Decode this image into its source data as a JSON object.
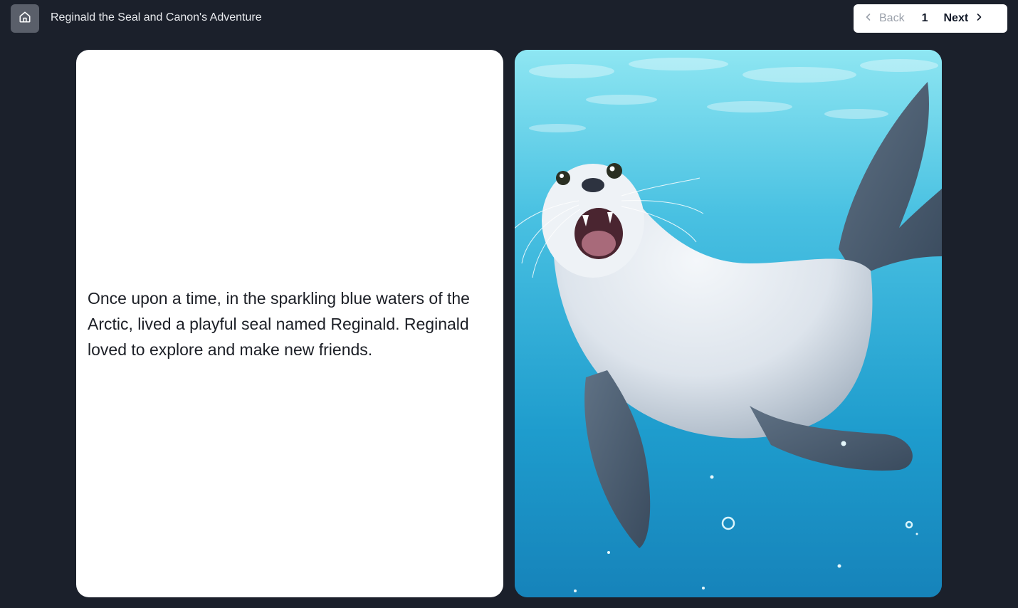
{
  "header": {
    "home_icon": "home-icon",
    "title": "Reginald the Seal and Canon's Adventure"
  },
  "pager": {
    "back_label": "Back",
    "page_number": "1",
    "next_label": "Next",
    "back_icon": "chevron-left-icon",
    "next_icon": "chevron-right-icon"
  },
  "page": {
    "text": "Once upon a time, in the sparkling blue waters of the Arctic, lived a playful seal named Reginald. Reginald loved to explore and make new friends."
  },
  "colors": {
    "background": "#1b202b",
    "page": "#ffffff",
    "water_light": "#6fd6ea",
    "water_deep": "#1781b7"
  }
}
